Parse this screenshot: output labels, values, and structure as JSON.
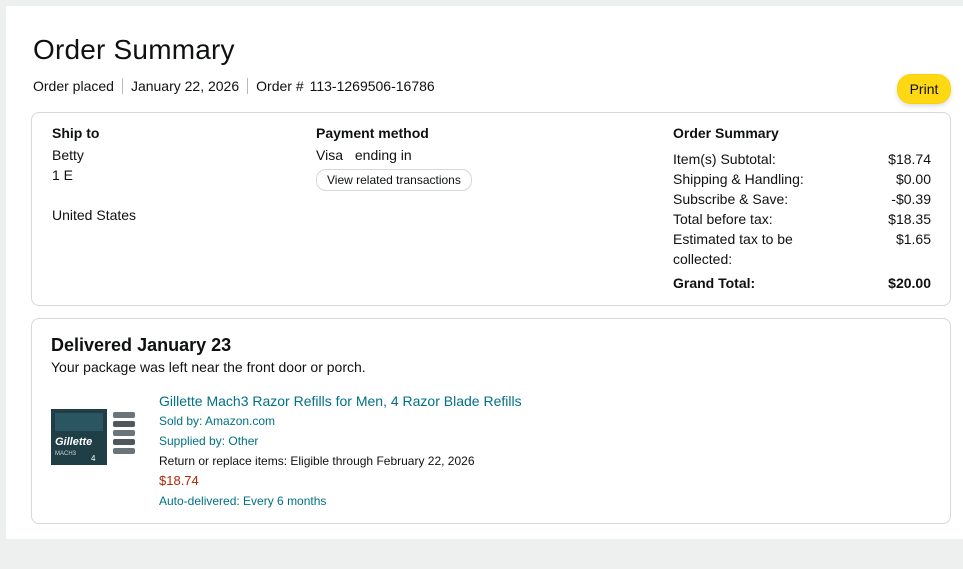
{
  "header": {
    "title": "Order Summary",
    "placed_label": "Order placed",
    "placed_date": "January 22, 2026",
    "order_label": "Order #",
    "order_number": "113-1269506-16786",
    "print_label": "Print"
  },
  "ship_to": {
    "heading": "Ship to",
    "name": "Betty",
    "address_line": "1  E",
    "country": "United States"
  },
  "payment": {
    "heading": "Payment method",
    "card_brand": "Visa",
    "card_detail": "ending in",
    "view_transactions": "View related transactions"
  },
  "order_summary": {
    "heading": "Order Summary",
    "rows": [
      {
        "label": "Item(s) Subtotal:",
        "value": "$18.74"
      },
      {
        "label": "Shipping & Handling:",
        "value": "$0.00"
      },
      {
        "label": "Subscribe & Save:",
        "value": "-$0.39"
      },
      {
        "label": "Total before tax:",
        "value": "$18.35"
      },
      {
        "label": "Estimated tax to be collected:",
        "value": "$1.65"
      },
      {
        "label": "Grand Total:",
        "value": "$20.00"
      }
    ]
  },
  "shipment": {
    "status": "Delivered",
    "date": "January 23",
    "note": "Your package was left near the front door or porch.",
    "thumb_label": "",
    "item_name": "Gillette Mach3 Razor Refills for Men, 4 Razor Blade Refills",
    "sold_by": "Sold by: Amazon.com",
    "supplied_by": "Supplied by: Other",
    "return_window": "Return or replace items: Eligible through February 22, 2026",
    "price": "$18.74",
    "auto_delivered": "Auto-delivered: Every 6 months"
  },
  "colors": {
    "accent_link": "#007185",
    "print_button": "#ffd814",
    "price": "#b12704"
  }
}
